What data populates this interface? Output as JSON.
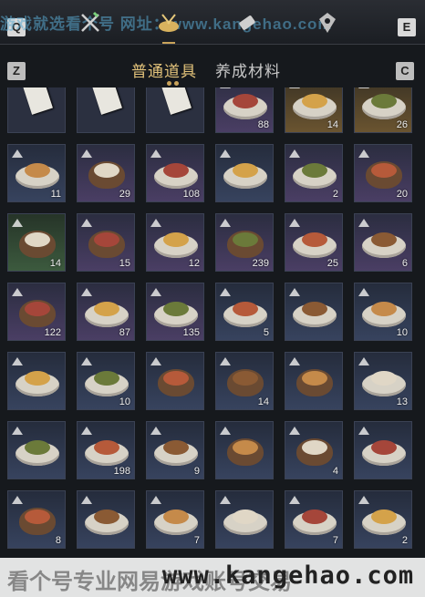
{
  "header": {
    "key_left": "Q",
    "key_right": "E",
    "watermark_top": "游戏就选看个号  网址：www.kangehao.com",
    "categories": [
      "consumable-icon",
      "weapon-icon",
      "food-icon",
      "scroll-icon",
      "gem-icon"
    ],
    "active_category": "food-icon"
  },
  "tabs": {
    "key_left": "Z",
    "key_right": "C",
    "items": [
      "普通道具",
      "养成材料"
    ],
    "active": "普通道具"
  },
  "grid": {
    "rows": [
      [
        {
          "icon": "ticket-icon",
          "qty": "",
          "tier": "gray"
        },
        {
          "icon": "ticket-icon",
          "qty": "",
          "tier": "gray"
        },
        {
          "icon": "ticket-icon",
          "qty": "",
          "tier": "gray"
        },
        {
          "icon": "necklace-icon",
          "qty": "88",
          "tier": "purple"
        },
        {
          "icon": "helmet-icon",
          "qty": "14",
          "tier": "gold"
        },
        {
          "icon": "gold-ingot-icon",
          "qty": "26",
          "tier": "gold"
        }
      ],
      [
        {
          "icon": "jade-stone-icon",
          "qty": "11",
          "tier": "blue"
        },
        {
          "icon": "dumpling-bowl-icon",
          "qty": "29",
          "tier": "purple"
        },
        {
          "icon": "rice-balls-icon",
          "qty": "108",
          "tier": "purple"
        },
        {
          "icon": "soup-plate-icon",
          "qty": "",
          "tier": "blue"
        },
        {
          "icon": "egg-plate-icon",
          "qty": "2",
          "tier": "purple"
        },
        {
          "icon": "stir-fry-bowl-icon",
          "qty": "20",
          "tier": "purple"
        }
      ],
      [
        {
          "icon": "stew-pot-icon",
          "qty": "14",
          "tier": "green"
        },
        {
          "icon": "noodle-bowl-icon",
          "qty": "15",
          "tier": "purple"
        },
        {
          "icon": "wine-vase-icon",
          "qty": "12",
          "tier": "purple"
        },
        {
          "icon": "meatball-bowl-icon",
          "qty": "239",
          "tier": "purple"
        },
        {
          "icon": "noodle-plate-icon",
          "qty": "25",
          "tier": "purple"
        },
        {
          "icon": "ham-leg-icon",
          "qty": "6",
          "tier": "purple"
        }
      ],
      [
        {
          "icon": "braised-pot-icon",
          "qty": "122",
          "tier": "purple"
        },
        {
          "icon": "dumpling-plate-icon",
          "qty": "87",
          "tier": "purple"
        },
        {
          "icon": "fish-plate-icon",
          "qty": "135",
          "tier": "purple"
        },
        {
          "icon": "ribs-plate-icon",
          "qty": "5",
          "tier": "blue"
        },
        {
          "icon": "meatball-plate-icon",
          "qty": "",
          "tier": "blue"
        },
        {
          "icon": "cake-plate-icon",
          "qty": "10",
          "tier": "blue"
        }
      ],
      [
        {
          "icon": "pancake-plate-icon",
          "qty": "",
          "tier": "blue"
        },
        {
          "icon": "greens-plate-icon",
          "qty": "10",
          "tier": "blue"
        },
        {
          "icon": "soup-bowl-icon",
          "qty": "",
          "tier": "blue"
        },
        {
          "icon": "shrimp-bowl-icon",
          "qty": "14",
          "tier": "blue"
        },
        {
          "icon": "broth-bowl-icon",
          "qty": "",
          "tier": "blue"
        },
        {
          "icon": "mushroom-plate-icon",
          "qty": "13",
          "tier": "blue"
        }
      ],
      [
        {
          "icon": "beef-plate-icon",
          "qty": "",
          "tier": "blue"
        },
        {
          "icon": "fried-noodle-plate-icon",
          "qty": "198",
          "tier": "blue"
        },
        {
          "icon": "clam-plate-icon",
          "qty": "9",
          "tier": "blue"
        },
        {
          "icon": "chili-chicken-bowl-icon",
          "qty": "",
          "tier": "blue"
        },
        {
          "icon": "clay-pot-icon",
          "qty": "4",
          "tier": "blue"
        },
        {
          "icon": "sliced-pork-plate-icon",
          "qty": "",
          "tier": "blue"
        }
      ],
      [
        {
          "icon": "congee-bowl-icon",
          "qty": "8",
          "tier": "blue"
        },
        {
          "icon": "fried-balls-plate-icon",
          "qty": "",
          "tier": "blue"
        },
        {
          "icon": "fried-pastry-plate-icon",
          "qty": "7",
          "tier": "blue"
        },
        {
          "icon": "egg-fried-rice-plate-icon",
          "qty": "",
          "tier": "blue"
        },
        {
          "icon": "layered-pancake-icon",
          "qty": "7",
          "tier": "blue"
        },
        {
          "icon": "dessert-plate-icon",
          "qty": "2",
          "tier": "blue"
        }
      ]
    ]
  },
  "footer": {
    "watermark_text": "看个号专业网易游戏账号交易",
    "watermark_url": "www.kangehao.com"
  },
  "colors": {
    "accent_gold": "#e2c27a",
    "panel_bg": "#16191d",
    "tier_purple": "#4a3e64",
    "tier_blue": "#37435e",
    "tier_gold": "#6a5430"
  }
}
